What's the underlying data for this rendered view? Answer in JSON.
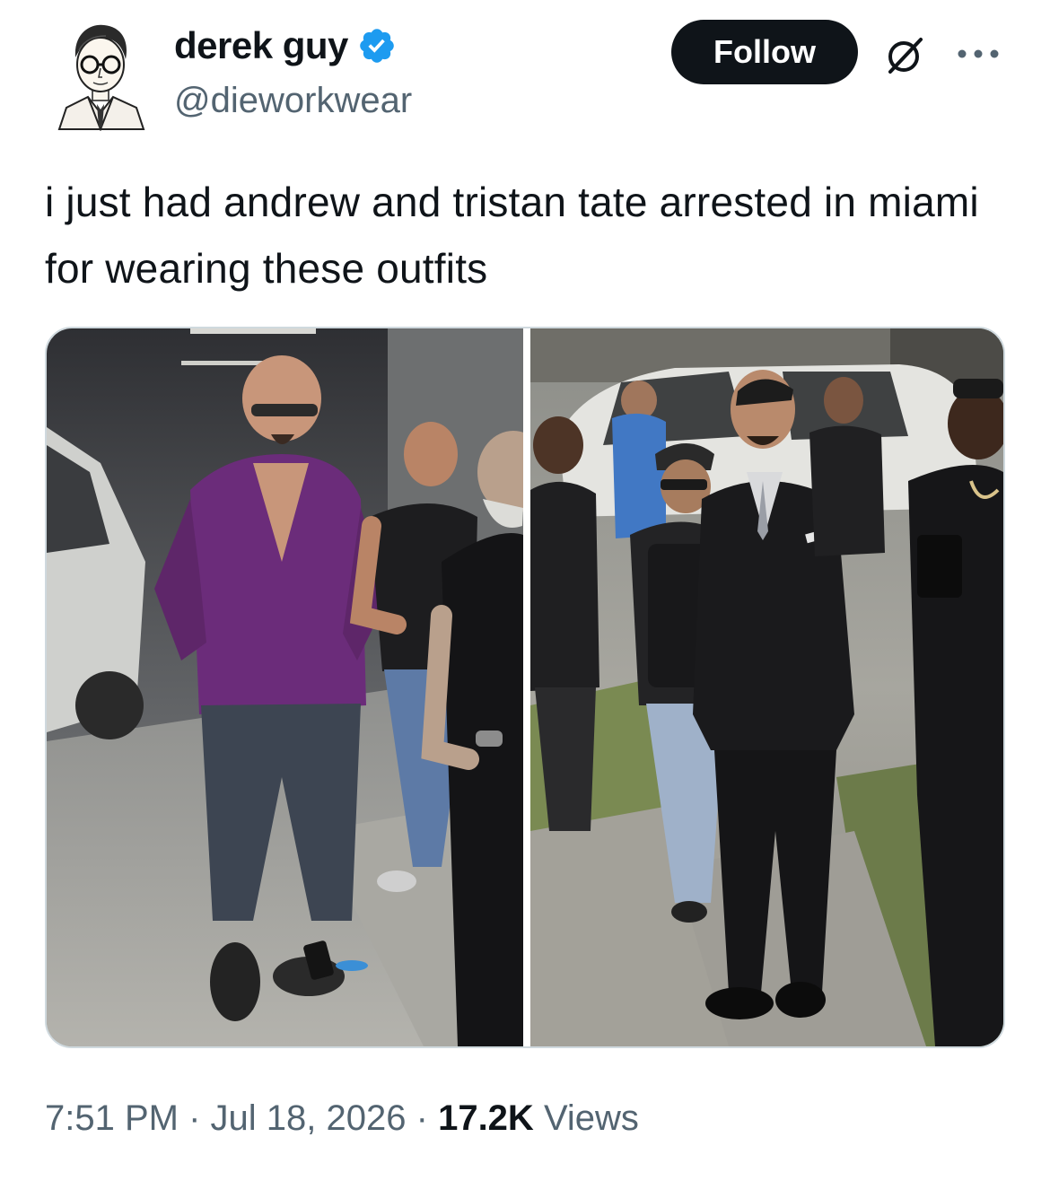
{
  "author": {
    "display_name": "derek guy",
    "handle": "@dieworkwear",
    "verified": true,
    "verified_color": "#1d9bf0"
  },
  "actions": {
    "follow_label": "Follow",
    "grok_icon": "grok-icon",
    "more_icon": "more-icon"
  },
  "tweet": {
    "text": "i just had andrew and tristan tate arrested in miami for wearing these outfits"
  },
  "media": {
    "photo_count": 2
  },
  "meta": {
    "time": "7:51 PM",
    "separator": "·",
    "date": "Jul 18, 2026",
    "views_count": "17.2K",
    "views_label": "Views"
  },
  "colors": {
    "text_primary": "#0f1419",
    "text_secondary": "#536471",
    "follow_bg": "#0f1419",
    "border": "#cfd9de"
  }
}
